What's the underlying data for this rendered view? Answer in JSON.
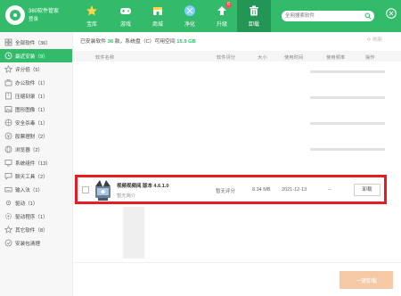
{
  "header": {
    "title": "360软件管家",
    "subtitle": "登录",
    "tabs": [
      {
        "label": "宝库",
        "icon": "star-icon"
      },
      {
        "label": "游戏",
        "icon": "gamepad-icon"
      },
      {
        "label": "商城",
        "icon": "store-icon"
      },
      {
        "label": "净化",
        "icon": "shield-icon"
      },
      {
        "label": "升级",
        "icon": "upgrade-icon",
        "badge": "6"
      },
      {
        "label": "卸载",
        "icon": "trash-icon"
      }
    ],
    "active_tab": "卸载",
    "search_placeholder": "全网搜索软件"
  },
  "sidebar": {
    "items": [
      {
        "label": "全部软件（36）",
        "icon": "grid-icon"
      },
      {
        "label": "最近安装（9）",
        "icon": "clock-icon"
      },
      {
        "label": "评分低（5）",
        "icon": "star-outline-icon"
      },
      {
        "label": "办公软件（1）",
        "icon": "briefcase-icon"
      },
      {
        "label": "压缩刻录（1）",
        "icon": "archive-icon"
      },
      {
        "label": "图形图像（1）",
        "icon": "image-icon"
      },
      {
        "label": "安全杀毒（1）",
        "icon": "security-icon"
      },
      {
        "label": "股票理财（2）",
        "icon": "finance-icon"
      },
      {
        "label": "浏览器（2）",
        "icon": "browser-icon"
      },
      {
        "label": "系统组件（13）",
        "icon": "system-icon"
      },
      {
        "label": "聊天工具（2）",
        "icon": "chat-icon"
      },
      {
        "label": "输入法（1）",
        "icon": "keyboard-icon"
      },
      {
        "label": "驱动（1）",
        "icon": "driver-icon"
      },
      {
        "label": "驱动程序（1）",
        "icon": "driver-program-icon"
      },
      {
        "label": "其它软件（8）",
        "icon": "other-icon"
      },
      {
        "label": "安装包清理",
        "icon": "clean-icon"
      }
    ],
    "active_index": 1
  },
  "info": {
    "prefix": "已安装软件",
    "count": "36",
    "mid": "款，系统盘（C）可用空间",
    "space": "15.9 GB"
  },
  "refresh_label": "刷新",
  "table": {
    "columns": [
      "软件名称",
      "软件评分",
      "大小",
      "使用时间",
      "使用频率",
      "操作"
    ]
  },
  "row": {
    "name": "视频视频阅 版本 4.6.1.0",
    "rating_sub": "暂无简介",
    "rating": "暂无评分",
    "size": "8.34 MB",
    "date": "2021-12-13",
    "frequency": "--",
    "action": "卸载"
  },
  "footer": {
    "one_click_label": "一键卸载"
  },
  "colors": {
    "brand": "#33bb6b",
    "highlight": "#e51c23",
    "button_disabled": "#f6c9a6"
  }
}
